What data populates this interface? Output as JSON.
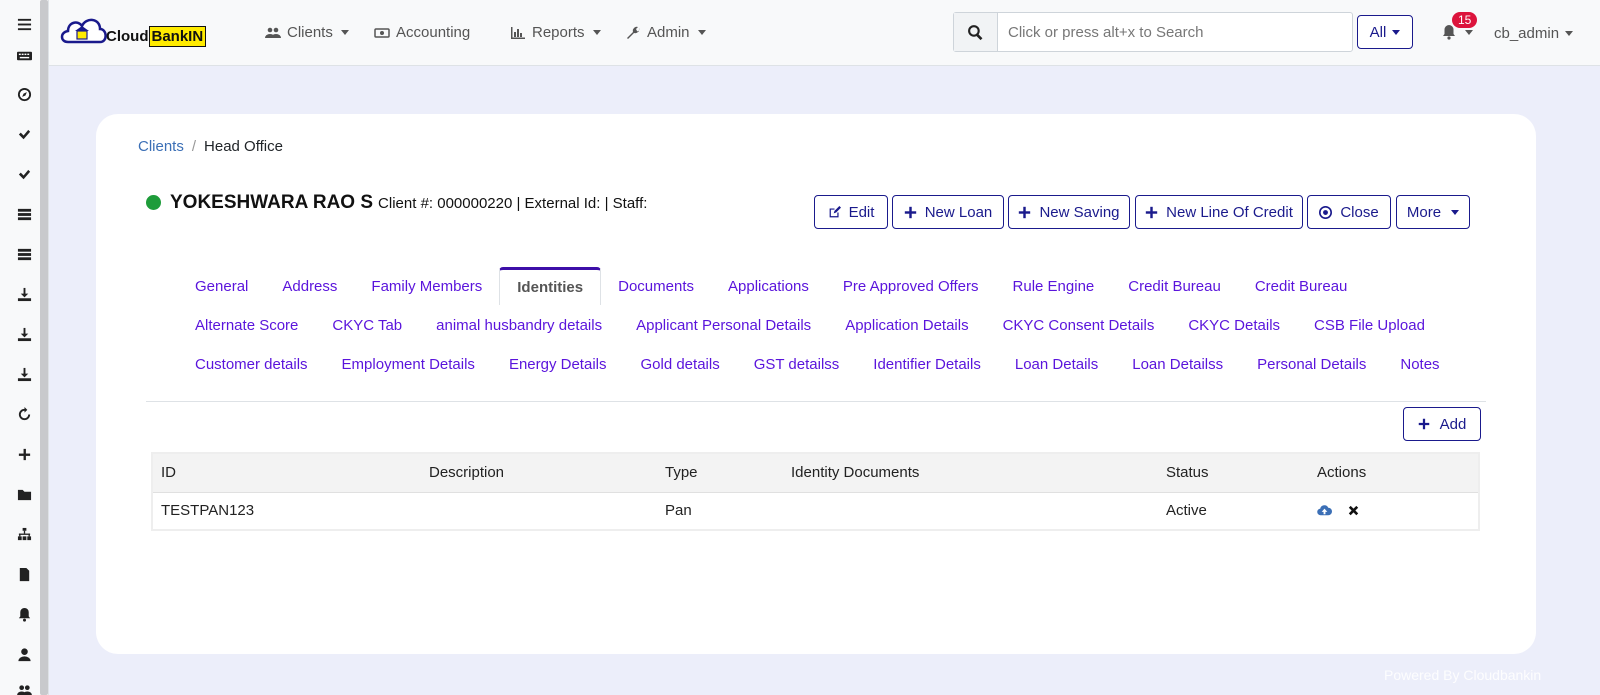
{
  "brand": {
    "logo_text_1": "Cloud",
    "logo_text_2": "BankIN"
  },
  "nav": {
    "clients": "Clients",
    "accounting": "Accounting",
    "reports": "Reports",
    "admin": "Admin"
  },
  "search": {
    "placeholder": "Click or press alt+x to Search",
    "scope": "All"
  },
  "notifications": {
    "count": "15"
  },
  "user": {
    "name": "cb_admin"
  },
  "breadcrumb": {
    "root": "Clients",
    "sep": "/",
    "current": "Head Office"
  },
  "client": {
    "name": "YOKESHWARA RAO S",
    "meta": "Client #: 000000220 | External Id: | Staff:",
    "status_color": "#1e9c3a"
  },
  "actions": {
    "edit": "Edit",
    "new_loan": "New Loan",
    "new_saving": "New Saving",
    "new_line_of_credit": "New Line Of Credit",
    "close": "Close",
    "more": "More"
  },
  "tabs_row1": [
    "General",
    "Address",
    "Family Members",
    "Identities",
    "Documents",
    "Applications",
    "Pre Approved Offers",
    "Rule Engine",
    "Credit Bureau",
    "Credit Bureau"
  ],
  "tabs_row2": [
    "Alternate Score",
    "CKYC Tab",
    "animal husbandry details",
    "Applicant Personal Details",
    "Application Details",
    "CKYC Consent Details",
    "CKYC Details",
    "CSB File Upload"
  ],
  "tabs_row3": [
    "Customer details",
    "Employment Details",
    "Energy Details",
    "Gold details",
    "GST detailss",
    "Identifier Details",
    "Loan Details",
    "Loan Detailss",
    "Personal Details",
    "Notes"
  ],
  "add_label": "Add",
  "table": {
    "headers": [
      "ID",
      "Description",
      "Type",
      "Identity Documents",
      "Status",
      "Actions"
    ],
    "rows": [
      {
        "id": "TESTPAN123",
        "description": "",
        "type": "Pan",
        "documents": "",
        "status": "Active"
      }
    ]
  },
  "footer": "Powered By Cloudbankin"
}
